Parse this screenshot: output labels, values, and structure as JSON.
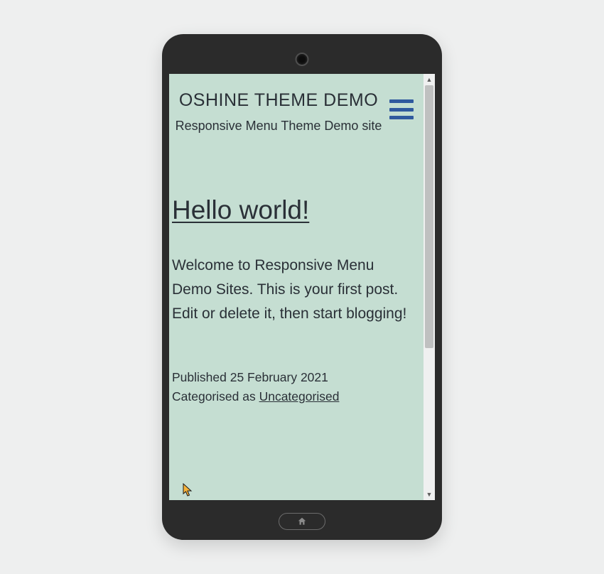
{
  "header": {
    "site_title": "OSHINE THEME DEMO",
    "site_tagline": "Responsive Menu Theme Demo site"
  },
  "post": {
    "title": "Hello world!",
    "body": "Welcome to Responsive Menu Demo Sites. This is your first post. Edit or delete it, then start blogging!",
    "published_prefix": "Published ",
    "published_date": "25 February 2021",
    "categorised_prefix": "Categorised as ",
    "category": "Uncategorised"
  },
  "icons": {
    "hamburger": "hamburger-menu-icon",
    "home": "home-icon",
    "scroll_up": "▲",
    "scroll_down": "▼"
  },
  "colors": {
    "page_bg": "#eeefef",
    "screen_bg": "#c5ded2",
    "hamburger": "#2f599e",
    "text": "#2a3037",
    "phone_frame": "#2b2b2b"
  }
}
